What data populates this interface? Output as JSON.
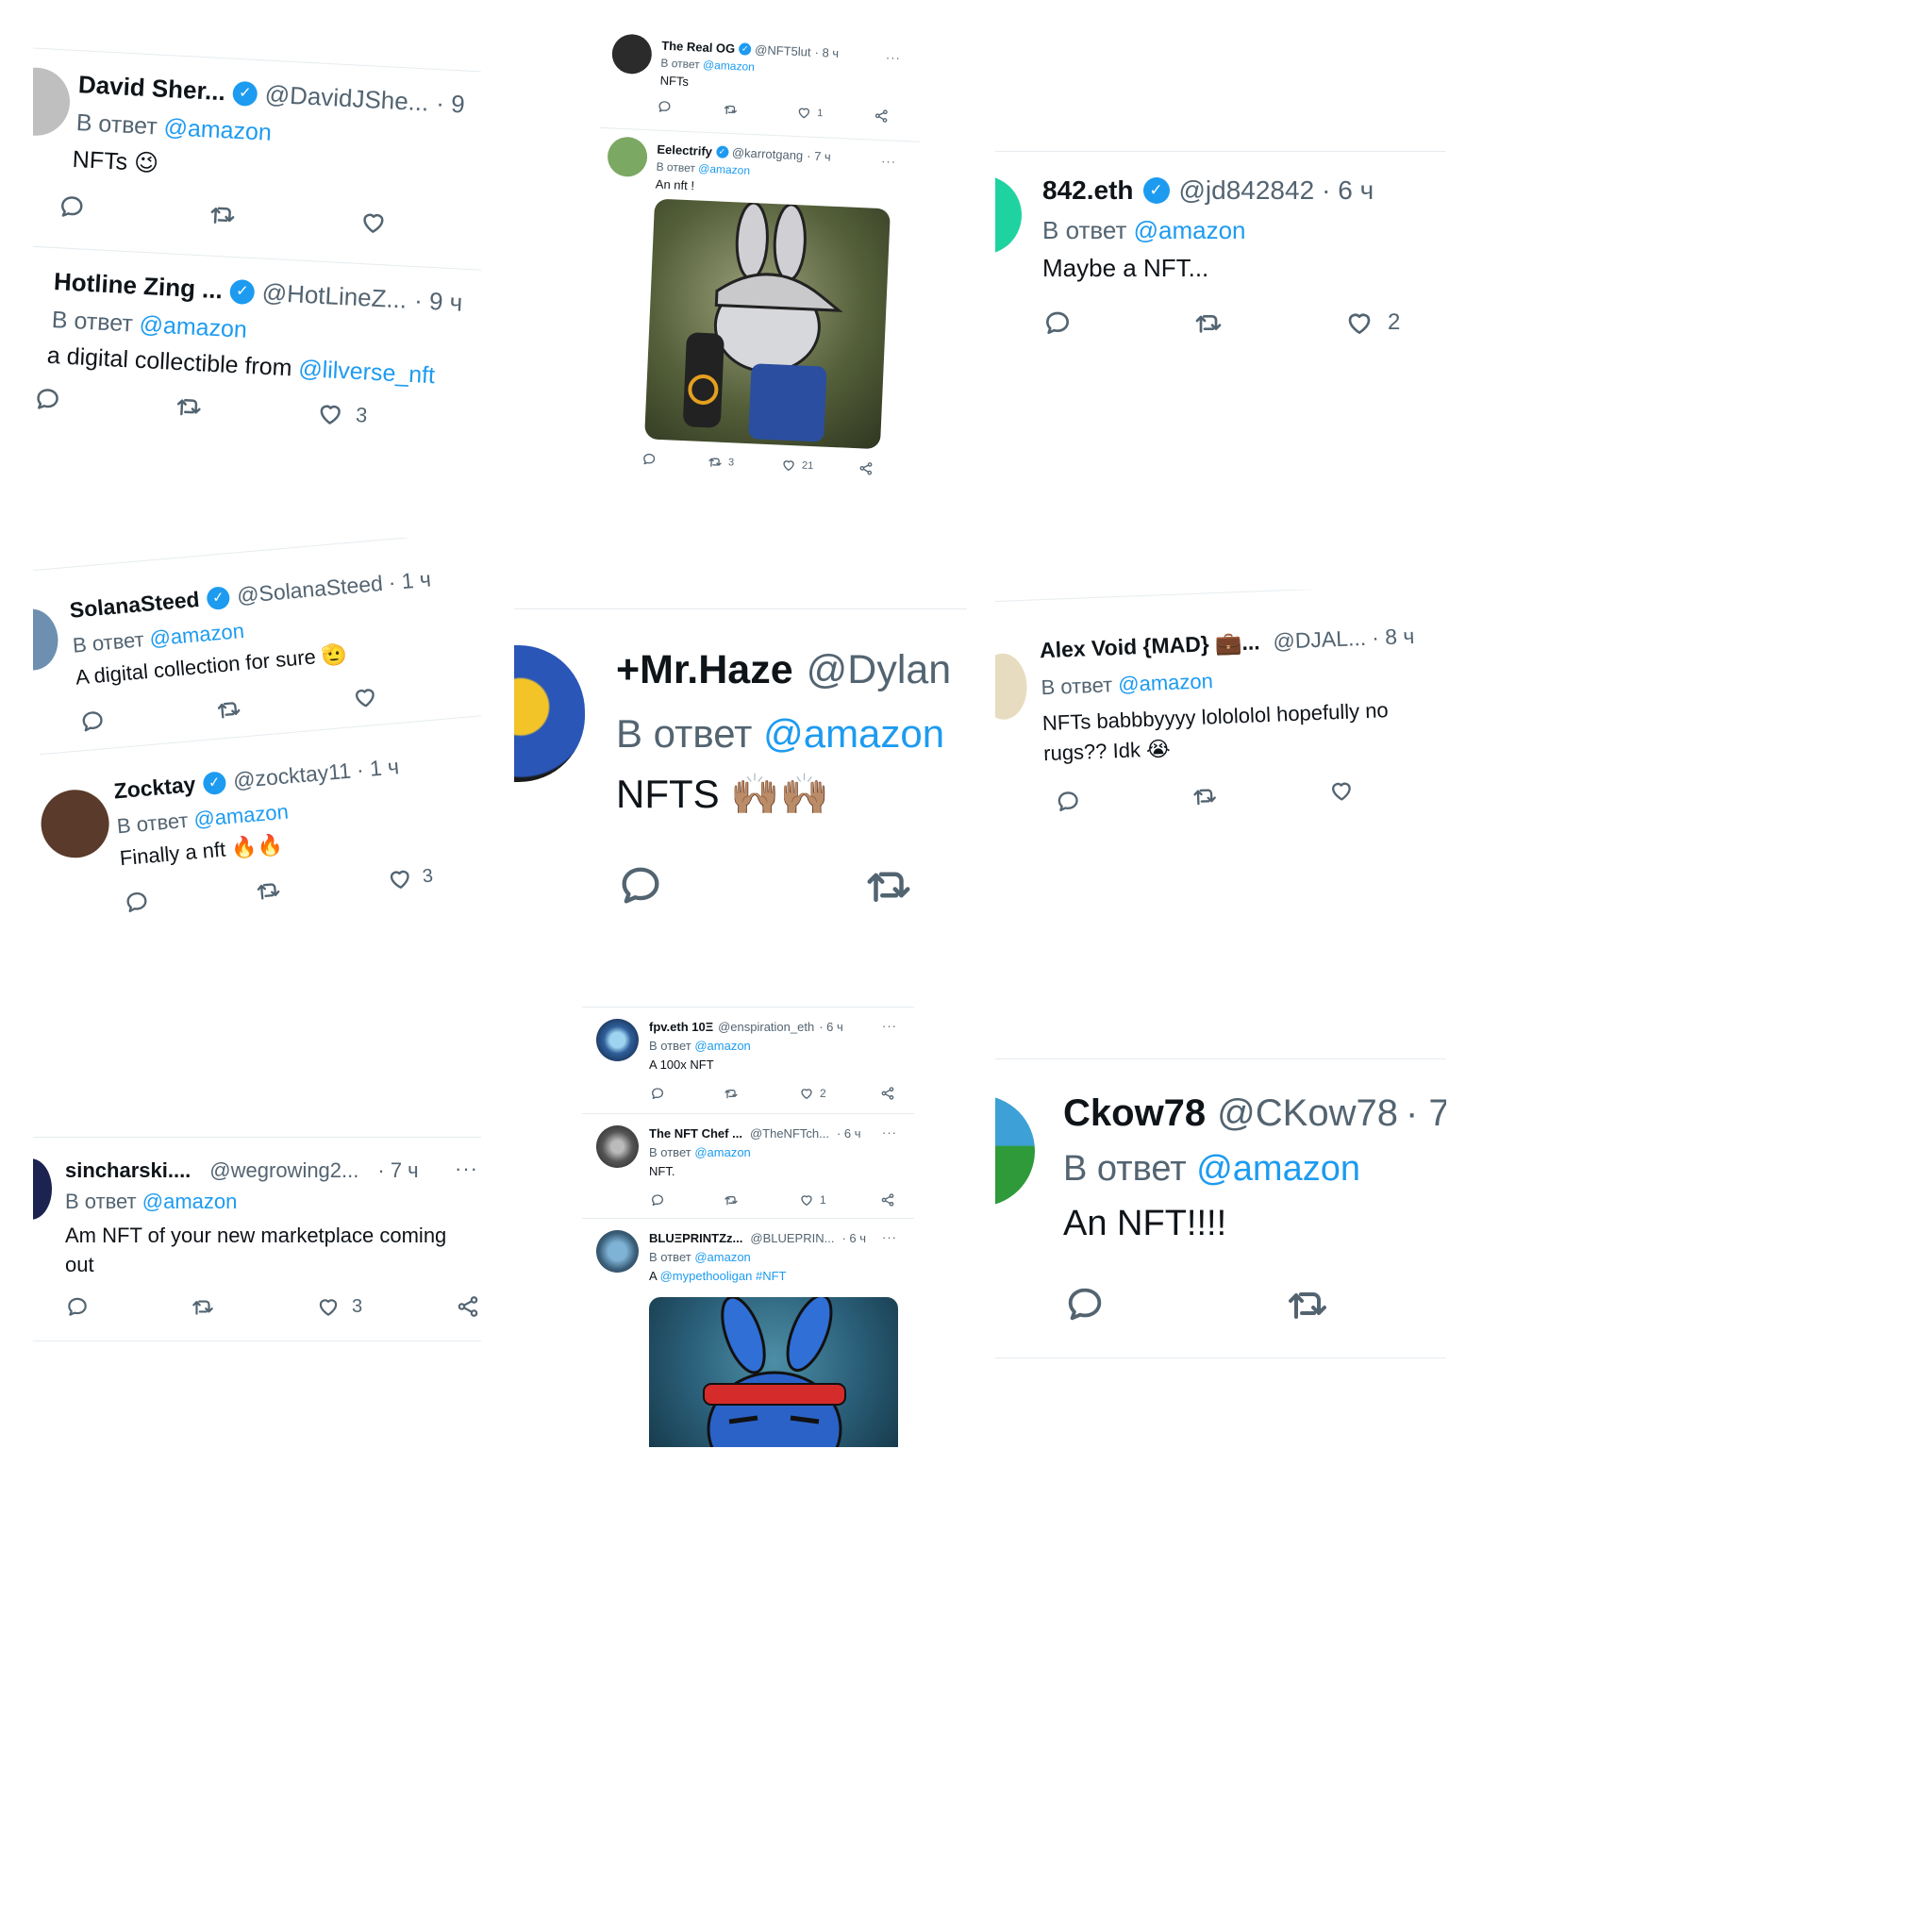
{
  "reply_prefix": "В ответ",
  "reply_target": "@amazon",
  "more_glyph": "···",
  "colors": {
    "accent": "#1d9bf0",
    "text": "#0f1419",
    "muted": "#536471",
    "divider": "#e6ecf0"
  },
  "icons": {
    "reply": "speech-bubble-icon",
    "retweet": "retweet-icon",
    "like": "heart-icon",
    "share": "share-icon",
    "verified": "verified-badge-icon",
    "more": "more-dots-icon"
  },
  "tweets": {
    "david": {
      "name": "David Sher...",
      "handle": "@DavidJShe...",
      "time": "· 9",
      "text": "NFTs",
      "emoji": "😉",
      "likes": ""
    },
    "hotline": {
      "name": "Hotline Zing ...",
      "handle": "@HotLineZ...",
      "time": "· 9 ч",
      "text": "a digital collectible from",
      "text_mention": "@lilverse_nft",
      "likes": "3"
    },
    "realog": {
      "name": "The Real OG",
      "handle": "@NFT5lut",
      "time": "· 8 ч",
      "text": "NFTs",
      "likes": "1"
    },
    "eelectrify": {
      "name": "Eelectrify",
      "handle": "@karrotgang",
      "time": "· 7 ч",
      "text": "An nft !",
      "retweets": "3",
      "likes": "21"
    },
    "eth842": {
      "name": "842.eth",
      "handle": "@jd842842",
      "time": "· 6 ч",
      "text": "Maybe a NFT...",
      "likes": "2"
    },
    "solana": {
      "name": "SolanaSteed",
      "handle": "@SolanaSteed",
      "time": "· 1 ч",
      "text": "A digital collection for sure",
      "emoji": "🫡",
      "likes": ""
    },
    "zocktay": {
      "name": "Zocktay",
      "handle": "@zocktay11",
      "time": "· 1 ч",
      "text": "Finally a nft",
      "emoji": "🔥🔥",
      "likes": "3"
    },
    "haze": {
      "name": "+Mr.Haze",
      "handle": "@Dylan",
      "text": "NFTS",
      "emoji": "🙌🏽🙌🏽"
    },
    "alexvoid": {
      "name": "Alex Void {MAD}",
      "emoji_name": "💼",
      "name_suffix": "...",
      "handle": "@DJAL...",
      "time": "· 8 ч",
      "text_line1": "NFTs babbbyyyy lolololol hopefully no",
      "text_line2": "rugs?? Idk",
      "emoji": "😭",
      "likes": ""
    },
    "sincharski": {
      "name": "sincharski....",
      "handle": "@wegrowing2...",
      "time": "· 7 ч",
      "text_line1": "Am NFT of your new marketplace coming",
      "text_line2": "out",
      "likes": "3"
    },
    "fpv": {
      "name": "fpv.eth 10Ξ",
      "handle": "@enspiration_eth",
      "time": "· 6 ч",
      "text": "A 100x NFT",
      "likes": "2"
    },
    "nftchef": {
      "name": "The NFT Chef ...",
      "handle": "@TheNFTch...",
      "time": "· 6 ч",
      "text": "NFT.",
      "likes": "1"
    },
    "blueprint": {
      "name": "BLUΞPRINTZz...",
      "handle": "@BLUEPRIN...",
      "time": "· 6 ч",
      "text": "A",
      "text_mention": "@mypethooligan #NFT"
    },
    "ckow": {
      "name": "Ckow78",
      "handle": "@CKow78",
      "time": "· 7 ч",
      "text": "An NFT!!!!"
    }
  }
}
